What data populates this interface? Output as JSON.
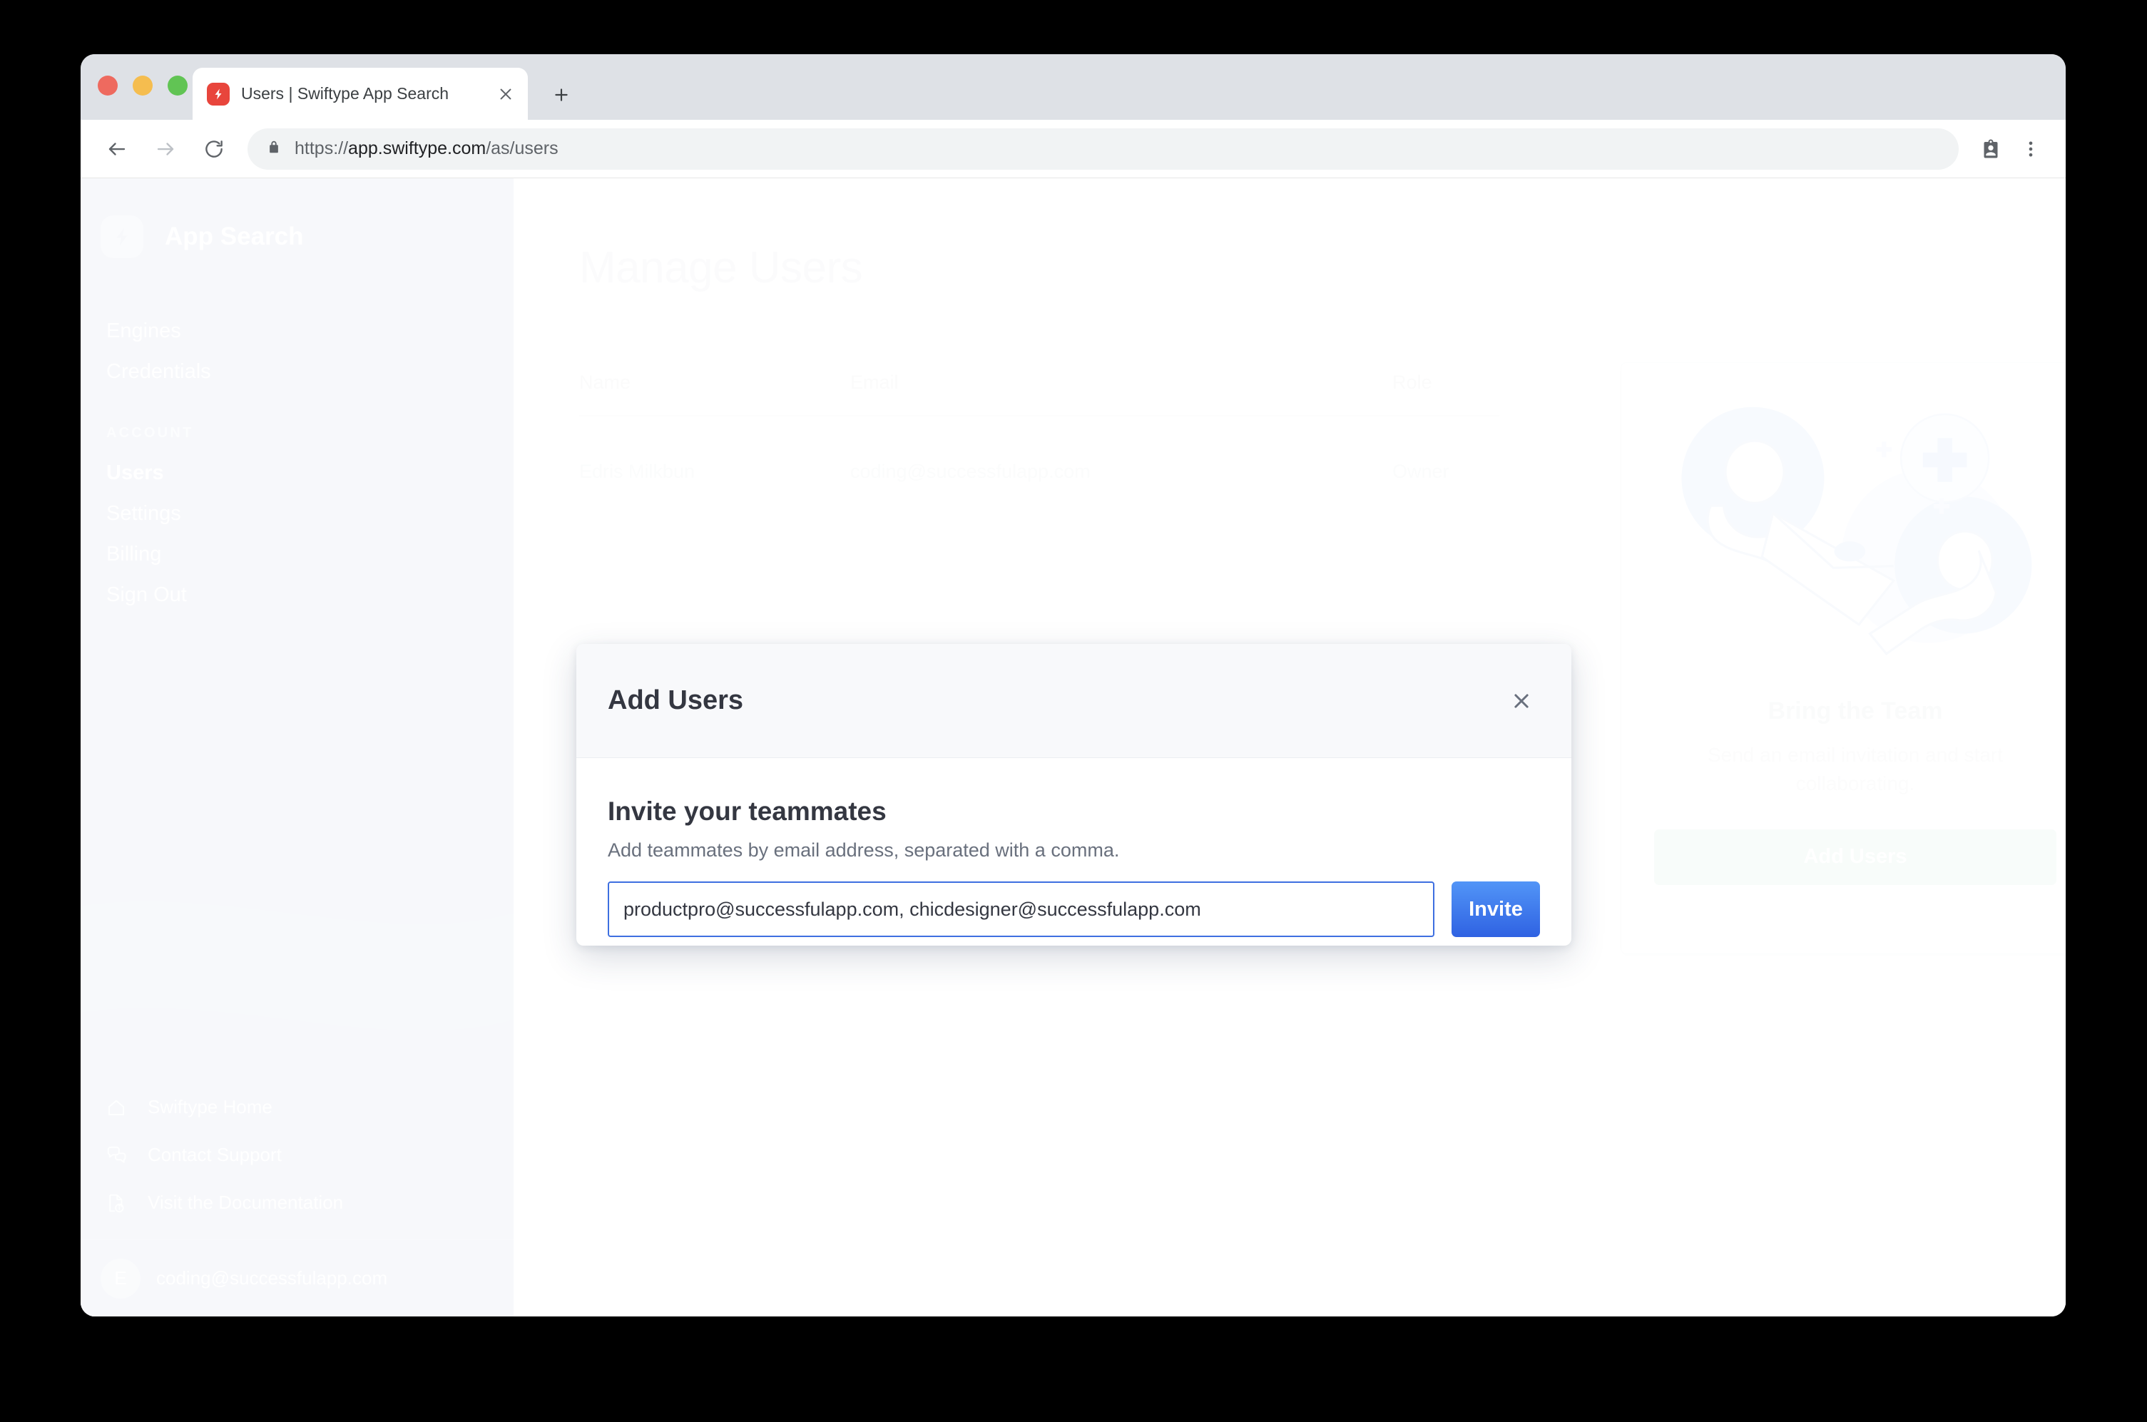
{
  "browser": {
    "tab": {
      "title": "Users | Swiftype App Search",
      "favicon_icon": "swiftype-bolt-icon",
      "close_icon": "close-icon"
    },
    "new_tab_icon": "plus-icon",
    "toolbar": {
      "back_icon": "back-arrow-icon",
      "forward_icon": "forward-arrow-icon",
      "reload_icon": "reload-icon",
      "lock_icon": "lock-icon",
      "url_scheme": "https://",
      "url_host": "app.swiftype.com",
      "url_path": "/as/users",
      "url_full": "https://app.swiftype.com/as/users",
      "profile_icon": "profile-badge-icon",
      "menu_icon": "three-dot-menu-icon"
    }
  },
  "sidebar": {
    "brand": {
      "logo_icon": "lightning-bolt-logo-icon",
      "name": "App Search"
    },
    "primary_items": [
      {
        "label": "Engines",
        "active": false
      },
      {
        "label": "Credentials",
        "active": false
      }
    ],
    "account_section_label": "ACCOUNT",
    "account_items": [
      {
        "label": "Users",
        "active": true
      },
      {
        "label": "Settings",
        "active": false
      },
      {
        "label": "Billing",
        "active": false
      },
      {
        "label": "Sign Out",
        "active": false
      }
    ],
    "bottom_links": [
      {
        "label": "Swiftype Home",
        "icon": "home-icon"
      },
      {
        "label": "Contact Support",
        "icon": "chat-bubbles-icon"
      },
      {
        "label": "Visit the Documentation",
        "icon": "document-info-icon"
      }
    ],
    "account_footer": {
      "avatar_initial": "E",
      "email": "coding@successfulapp.com"
    },
    "background_color": "#d4dcea"
  },
  "main": {
    "page_title": "Manage Users",
    "table": {
      "columns": [
        "Name",
        "Email",
        "Role"
      ],
      "rows": [
        {
          "name": "Edris Milkbun",
          "email": "coding@successfulapp.com",
          "role": "Owner"
        }
      ]
    },
    "team_card": {
      "illustration_icon": "two-people-sharing-envelope-illustration",
      "title": "Bring the Team",
      "description": "Send an email invitation and start collaborating.",
      "button_label": "Add Users",
      "button_color": "#dcefe3"
    }
  },
  "modal": {
    "title": "Add Users",
    "close_icon": "close-icon",
    "heading": "Invite your teammates",
    "subtext": "Add teammates by email address, separated with a comma.",
    "input_value": "productpro@successfulapp.com, chicdesigner@successfulapp.com",
    "input_placeholder": "",
    "invite_button_label": "Invite",
    "accent_color": "#3e6fe0"
  }
}
